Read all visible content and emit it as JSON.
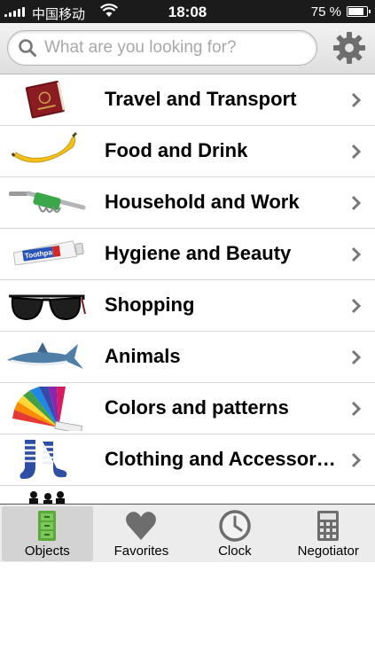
{
  "status_bar": {
    "carrier": "中国移动",
    "time": "18:08",
    "battery_percent_text": "75 %",
    "battery_level": 0.75,
    "signal_icon": "signal-bars-icon",
    "wifi_icon": "wifi-icon"
  },
  "search": {
    "placeholder": "What are you looking for?",
    "value": "",
    "icon": "search-icon"
  },
  "settings": {
    "icon": "gear-icon"
  },
  "categories": [
    {
      "label": "Travel and Transport",
      "icon": "passport-icon"
    },
    {
      "label": "Food and Drink",
      "icon": "banana-icon"
    },
    {
      "label": "Household and Work",
      "icon": "corkscrew-icon"
    },
    {
      "label": "Hygiene and Beauty",
      "icon": "toothpaste-icon"
    },
    {
      "label": "Shopping",
      "icon": "sunglasses-icon"
    },
    {
      "label": "Animals",
      "icon": "shark-icon"
    },
    {
      "label": "Colors and patterns",
      "icon": "color-fan-icon"
    },
    {
      "label": "Clothing and Accessories",
      "icon": "socks-icon"
    },
    {
      "label": "",
      "icon": "people-icon"
    }
  ],
  "toothpaste_text": "Toothpaste",
  "tabs": [
    {
      "label": "Objects",
      "icon": "objects-icon",
      "active": true
    },
    {
      "label": "Favorites",
      "icon": "heart-icon",
      "active": false
    },
    {
      "label": "Clock",
      "icon": "clock-icon",
      "active": false
    },
    {
      "label": "Negotiator",
      "icon": "calculator-icon",
      "active": false
    }
  ],
  "colors": {
    "status_bar": "#1b1b1b",
    "tab_active": "#d3d3d3",
    "objects_icon_green": "#5aaa3a"
  }
}
